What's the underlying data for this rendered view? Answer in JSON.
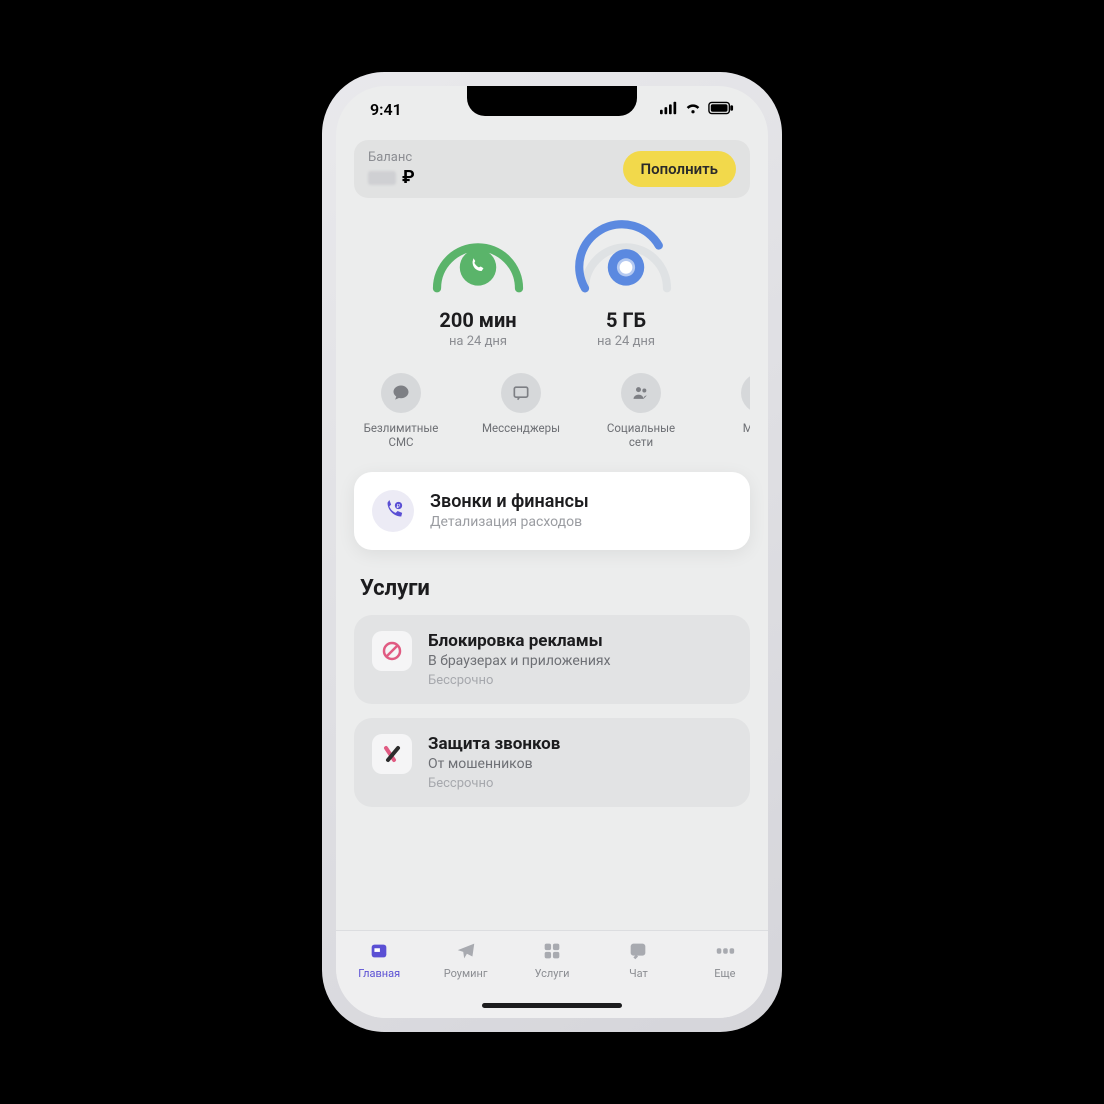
{
  "status": {
    "time": "9:41"
  },
  "balance": {
    "label": "Баланс",
    "currency": "₽",
    "topup": "Пополнить"
  },
  "gauges": [
    {
      "value": "200 мин",
      "sub": "на 24 дня",
      "color": "#5ab46a",
      "icon": "phone"
    },
    {
      "value": "5 ГБ",
      "sub": "на 24 дня",
      "color": "#5b89e0",
      "icon": "globe"
    }
  ],
  "quick": [
    {
      "label": "Безлимитные СМС",
      "icon": "chat"
    },
    {
      "label": "Мессенджеры",
      "icon": "message"
    },
    {
      "label": "Социальные сети",
      "icon": "people"
    },
    {
      "label": "Музык",
      "icon": "music"
    }
  ],
  "finance_card": {
    "title": "Звонки и финансы",
    "subtitle": "Детализация расходов"
  },
  "services_title": "Услуги",
  "services": [
    {
      "title": "Блокировка рекламы",
      "subtitle": "В браузерах и приложениях",
      "duration": "Бессрочно",
      "icon": "block",
      "icon_color": "#e05b82"
    },
    {
      "title": "Защита звонков",
      "subtitle": "От мошенников",
      "duration": "Бессрочно",
      "icon": "shield",
      "icon_color": "#2c2c2c"
    }
  ],
  "tabs": [
    {
      "label": "Главная",
      "icon": "home",
      "active": true
    },
    {
      "label": "Роуминг",
      "icon": "plane",
      "active": false
    },
    {
      "label": "Услуги",
      "icon": "grid",
      "active": false
    },
    {
      "label": "Чат",
      "icon": "chatsq",
      "active": false
    },
    {
      "label": "Еще",
      "icon": "more",
      "active": false
    }
  ]
}
